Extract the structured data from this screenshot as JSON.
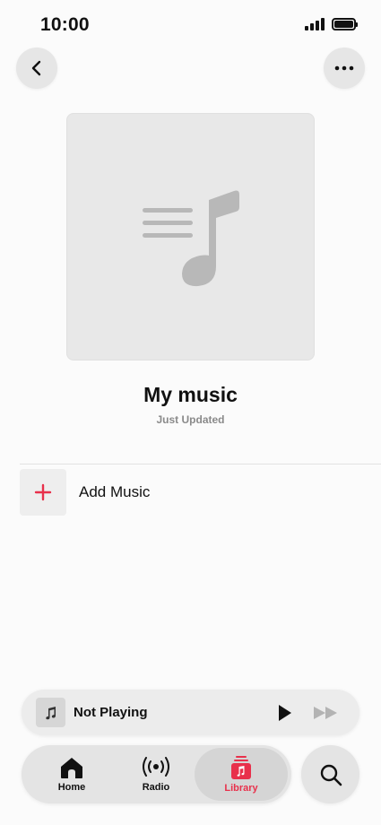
{
  "status_bar": {
    "time": "10:00",
    "icons": [
      "signal-icon",
      "battery-icon"
    ]
  },
  "header": {
    "back_icon": "chevron-left-icon",
    "more_icon": "ellipsis-icon"
  },
  "playlist": {
    "artwork_icon": "playlist-music-note-icon",
    "title": "My music",
    "subtitle": "Just Updated"
  },
  "actions": {
    "add_music_label": "Add Music",
    "add_icon": "plus-icon"
  },
  "mini_player": {
    "title": "Not Playing",
    "art_icon": "music-note-icon",
    "play_icon": "play-icon",
    "forward_icon": "fast-forward-icon"
  },
  "tab_bar": {
    "tabs": [
      {
        "label": "Home",
        "icon": "home-icon",
        "selected": false
      },
      {
        "label": "Radio",
        "icon": "radio-broadcast-icon",
        "selected": false
      },
      {
        "label": "Library",
        "icon": "library-icon",
        "selected": true
      }
    ],
    "search_icon": "search-icon"
  },
  "colors": {
    "accent": "#e8304b",
    "background": "#fbfbfb",
    "artwork_bg": "#e8e8e8",
    "artwork_glyph": "#b8b8b8"
  }
}
